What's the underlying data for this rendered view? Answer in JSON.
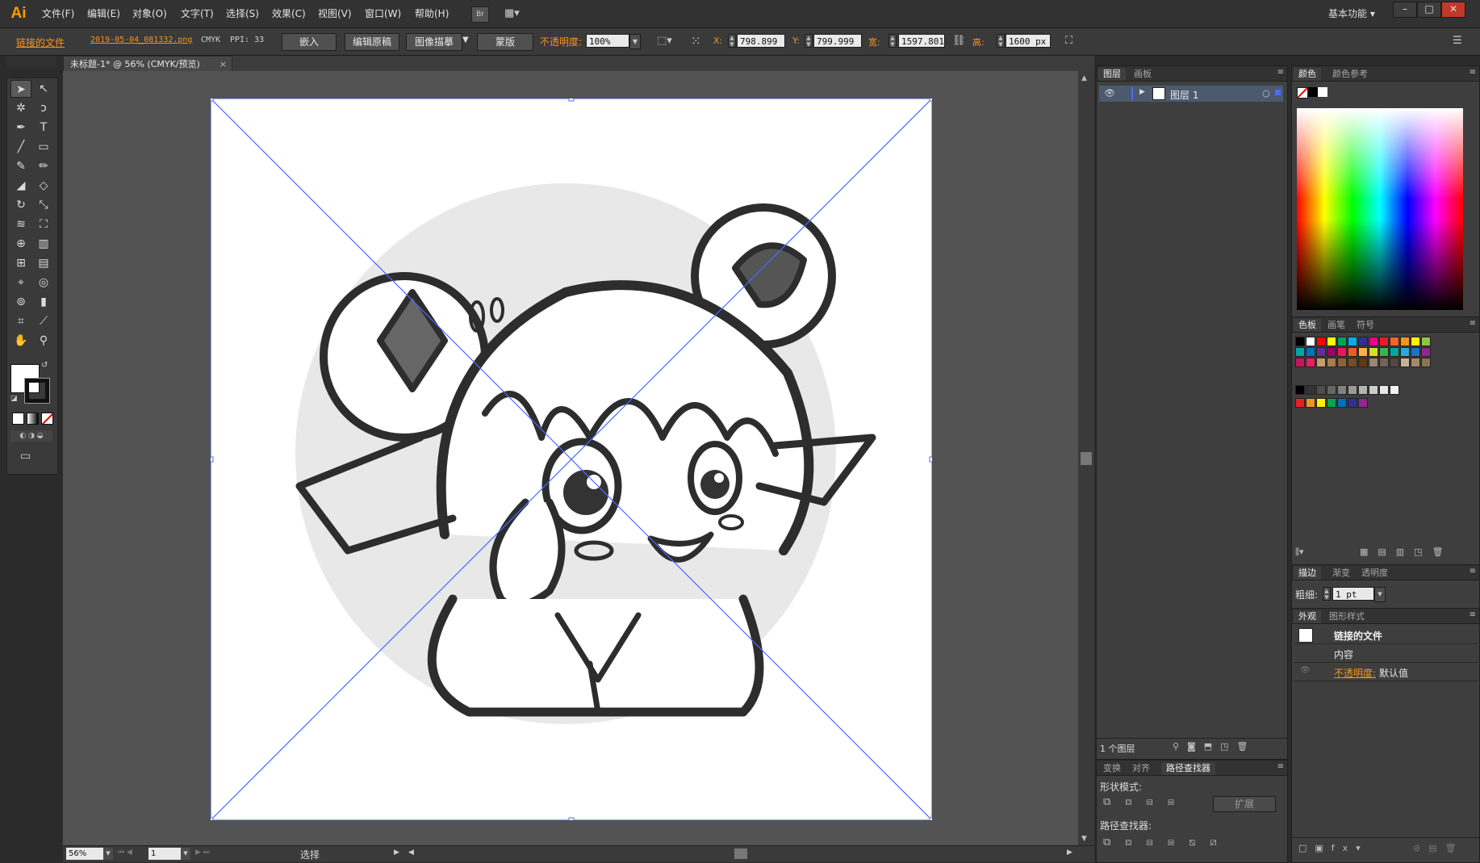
{
  "app": {
    "logo": "Ai",
    "menus": [
      "文件(F)",
      "编辑(E)",
      "对象(O)",
      "文字(T)",
      "选择(S)",
      "效果(C)",
      "视图(V)",
      "窗口(W)",
      "帮助(H)"
    ],
    "bridge_label": "Br",
    "workspace": "基本功能",
    "window_controls": [
      "–",
      "□",
      "✕"
    ]
  },
  "control_bar": {
    "linked_file_label": "链接的文件",
    "filename": "2019-05-04_081332.png",
    "color_mode": "CMYK",
    "ppi": "PPI: 33",
    "embed_btn": "嵌入",
    "edit_original_btn": "编辑原稿",
    "image_trace_btn": "图像描摹",
    "mask_btn": "蒙版",
    "opacity_label": "不透明度:",
    "opacity_value": "100%",
    "x_label": "X:",
    "x_value": "798.899",
    "y_label": "Y:",
    "y_value": "799.999",
    "w_label": "宽:",
    "w_value": "1597.801",
    "h_label": "高:",
    "h_value": "1600 px"
  },
  "document": {
    "tab_title": "未标题-1* @ 56% (CMYK/预览)",
    "zoom": "56%",
    "page": "1",
    "status": "选择"
  },
  "layers_panel": {
    "tabs": [
      "图层",
      "画板"
    ],
    "layer_name": "图层 1",
    "layer_count": "1 个图层"
  },
  "pathfinder_panel": {
    "tabs": [
      "变换",
      "对齐",
      "路径查找器"
    ],
    "shape_modes_label": "形状模式:",
    "expand_btn": "扩展",
    "pathfinders_label": "路径查找器:"
  },
  "color_panel": {
    "tabs": [
      "颜色",
      "颜色参考"
    ]
  },
  "swatches_panel": {
    "tabs": [
      "色板",
      "画笔",
      "符号"
    ],
    "colors": [
      "#000000",
      "#ffffff",
      "#ff0000",
      "#ffff00",
      "#00a651",
      "#00aeef",
      "#2e3192",
      "#ec008c",
      "#ed1c24",
      "#f26522",
      "#f7941d",
      "#fff200",
      "#8dc63f",
      "#00a99d",
      "#0072bc",
      "#662d91",
      "#9e005d",
      "#ed145b",
      "#f15a24",
      "#fbb040",
      "#d9e021",
      "#39b54a",
      "#00a79d",
      "#27aae1",
      "#1b75bc",
      "#92278f",
      "#c2185b",
      "#e91e63",
      "#c69c6d",
      "#a67c52",
      "#8c6239",
      "#754c24",
      "#603813",
      "#998675",
      "#736357",
      "#534741",
      "#c7b299",
      "#a38a6d",
      "#8b7355"
    ],
    "grays": [
      "#000000",
      "#333333",
      "#4d4d4d",
      "#666666",
      "#808080",
      "#999999",
      "#b3b3b3",
      "#cccccc",
      "#e6e6e6",
      "#f2f2f2"
    ],
    "extra": [
      "#ed1c24",
      "#f7941d",
      "#fff200",
      "#00a651",
      "#0072bc",
      "#2e3192",
      "#92278f"
    ]
  },
  "stroke_panel": {
    "tabs": [
      "描边",
      "渐变",
      "透明度"
    ],
    "weight_label": "粗细:",
    "weight_value": "1 pt"
  },
  "appearance_panel": {
    "tabs": [
      "外观",
      "图形样式"
    ],
    "item_title": "链接的文件",
    "content_label": "内容",
    "opacity_label": "不透明度:",
    "opacity_value": "默认值"
  },
  "colors": {
    "accent": "#f7931e",
    "selection_blue": "#4a6cff"
  }
}
